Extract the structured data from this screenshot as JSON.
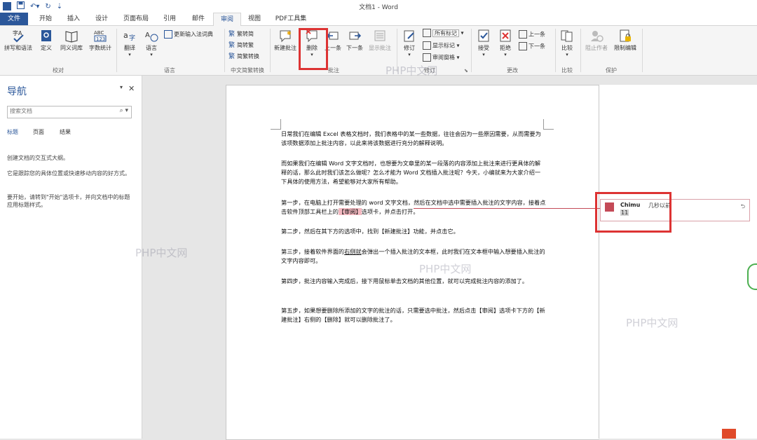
{
  "title_bar": {
    "title": "文档1 - Word"
  },
  "tabs": [
    "文件",
    "开始",
    "插入",
    "设计",
    "页面布局",
    "引用",
    "邮件",
    "审阅",
    "视图",
    "PDF工具集"
  ],
  "ribbon": {
    "proofing": {
      "spell": "拼写和语法",
      "define": "定义",
      "thesaurus": "同义词库",
      "wordcount": "字数统计",
      "label": "校对"
    },
    "language": {
      "translate": "翻译",
      "language": "语言",
      "update_ime": "更新输入法词典",
      "label": "语言"
    },
    "chinese": {
      "trad": "繁转简",
      "simp": "简转繁",
      "convert": "简繁转换",
      "label": "中文简繁转换"
    },
    "comments": {
      "new": "新建批注",
      "delete": "删除",
      "prev": "上一条",
      "next": "下一条",
      "show": "显示批注",
      "label": "批注"
    },
    "tracking": {
      "track": "修订",
      "markup_select": "所有标记",
      "show_markup": "显示标记",
      "review_pane": "审阅窗格",
      "label": "修订"
    },
    "changes": {
      "accept": "接受",
      "reject": "拒绝",
      "prev": "上一条",
      "next": "下一条",
      "label": "更改"
    },
    "compare": {
      "compare": "比较",
      "label": "比较"
    },
    "protect": {
      "block": "阻止作者",
      "restrict": "限制编辑",
      "label": "保护"
    }
  },
  "nav": {
    "title": "导航",
    "search_placeholder": "搜索文档",
    "tabs": [
      "标题",
      "页面",
      "结果"
    ],
    "text1": "创建文档的交互式大纲。",
    "text2": "它是跟踪您的具体位置或快速移动内容的好方式。",
    "text3": "要开始，请转到\"开始\"选项卡，并向文档中的标题应用标题样式。"
  },
  "document": {
    "p1": "日常我们在编辑 Excel 表格文档时，我们表格中的某一些数据，往往会因为一些原因需要，从而需要为该项数据添加上批注内容，以此来将该数据进行充分的解释说明。",
    "p2": "而如果我们在编辑 Word 文字文档时，也想要为文章里的某一段落的内容添加上批注来进行更具体的解释的话，那么此时我们该怎么做呢？怎么才能为 Word 文档插入批注呢？今天，小编就来为大家介绍一下具体的使用方法，希望能够对大家所有帮助。",
    "p3a": "第一步，在电脑上打开需要处理的 word 文字文档，然后在文档中选中需要插入批注的文字内容，接着点击软件顶部工具栏上的",
    "p3hl": "【审阅】",
    "p3b": "选项卡，并点击打开。",
    "p4": "第二步，然后在其下方的选项中，找到【新建批注】功能，并点击它。",
    "p5a": "第三步，接着软件界面的",
    "p5u": "右侧就",
    "p5b": "会弹出一个插入批注的文本框，此时我们在文本框中输入想要插入批注的文字内容即可。",
    "p6": "第四步，批注内容输入完成后，接下用鼠标单击文档的其他位置，就可以完成批注内容的添加了。",
    "p7": "第五步，如果想要删除所添加的文字的批注的话，只需要选中批注，然后点击【审阅】选项卡下方的【新建批注】右侧的【删除】就可以删除批注了。"
  },
  "comment": {
    "author": "Chimu",
    "time": "几秒以前",
    "text": "11"
  },
  "watermark": "PHP中文网",
  "colors": {
    "accent": "#2b579a",
    "highlight_box": "#dd3333",
    "comment_border": "#d9a0a8"
  }
}
